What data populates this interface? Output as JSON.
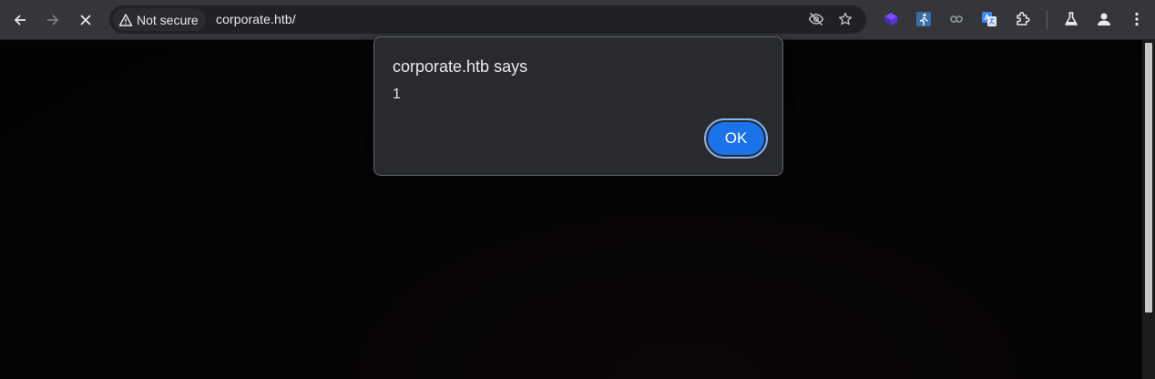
{
  "browser": {
    "security_label": "Not secure",
    "url": "corporate.htb/"
  },
  "page": {
    "dialog": {
      "title": "corporate.htb says",
      "message": "1",
      "ok_label": "OK"
    }
  },
  "icons": {
    "back": "back-arrow-icon",
    "forward": "forward-arrow-icon",
    "stop": "close-icon",
    "warning": "warning-triangle-icon",
    "eye_off": "eye-off-icon",
    "bookmark": "star-icon",
    "extensions": "puzzle-piece-icon",
    "labs": "flask-icon",
    "profile": "person-icon",
    "menu": "kebab-menu-icon"
  },
  "colors": {
    "accent": "#1a73e8",
    "focus_ring": "#8ab4f8",
    "dialog_bg": "#292a2d",
    "toolbar_bg": "#35363a"
  }
}
